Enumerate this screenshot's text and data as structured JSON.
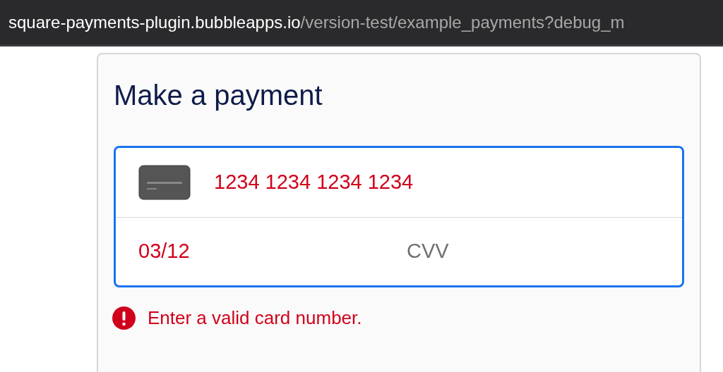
{
  "address_bar": {
    "domain": "square-payments-plugin.bubbleapps.io",
    "path": "/version-test/example_payments?debug_m"
  },
  "card": {
    "title": "Make a payment",
    "payment_form": {
      "focused": true,
      "card_number": {
        "value": "1234 1234 1234 1234",
        "invalid": true
      },
      "expiry": {
        "value": "03/12",
        "invalid": true
      },
      "cvv": {
        "placeholder": "CVV"
      }
    },
    "error": "Enter a valid card number."
  }
}
